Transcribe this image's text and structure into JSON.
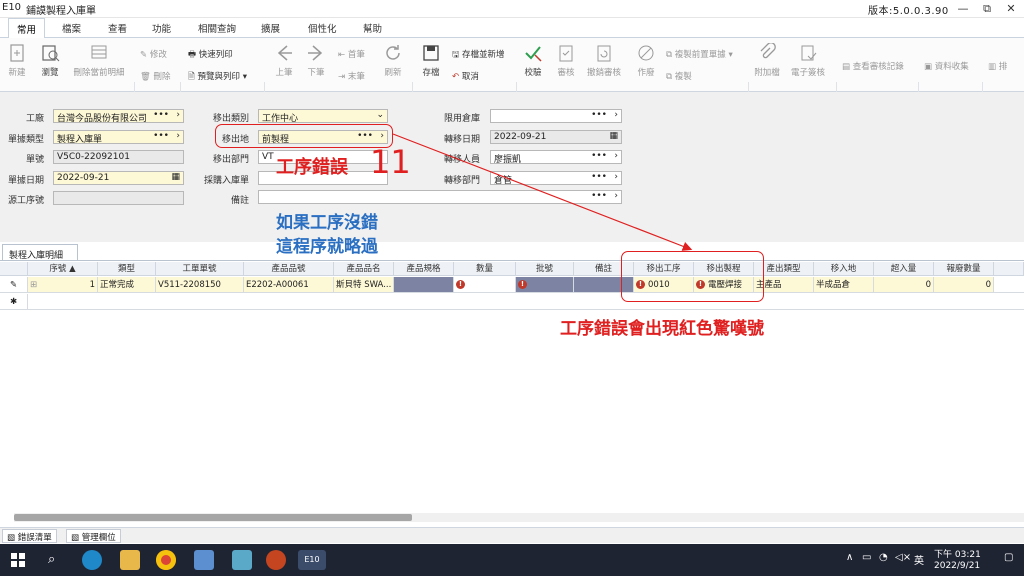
{
  "titlebar": {
    "app": "E10",
    "title": "鋪謨製程入庫單",
    "version": "版本:5.0.0.3.90",
    "minimize": "—",
    "restore": "⧉",
    "close": "✕"
  },
  "menu": [
    "常用",
    "檔案",
    "查看",
    "功能",
    "相關查詢",
    "擴展",
    "個性化",
    "幫助"
  ],
  "ribbon": {
    "new": "新建",
    "browse": "瀏覽",
    "delete_current": "刪除當前明細",
    "modify": "修改",
    "delete": "刪除",
    "quick_print": "快速列印",
    "preview_print": "預覽與列印",
    "prev": "上筆",
    "next": "下筆",
    "first": "首筆",
    "last": "末筆",
    "refresh": "刷新",
    "save": "存檔",
    "save_new": "存檔並新增",
    "cancel": "取消",
    "verify": "校驗",
    "approve": "審核",
    "unapprove": "撤銷審核",
    "void": "作廢",
    "copy_prev": "複製前置單據",
    "copy": "複製",
    "attach": "附加檔",
    "esign": "電子簽核",
    "view_audit": "查看審核記錄",
    "collect": "資料收集",
    "ext": "排"
  },
  "form": {
    "factory_label": "工廠",
    "factory_value": "台灣今品股份有限公司",
    "doctype_label": "單據類型",
    "doctype_value": "製程入庫單",
    "docno_label": "單號",
    "docno_value": "V5C0-22092101",
    "docdate_label": "單據日期",
    "docdate_value": "2022-09-21",
    "source_label": "源工序號",
    "source_value": "",
    "outtype_label": "移出類別",
    "outtype_value": "工作中心",
    "outplace_label": "移出地",
    "outplace_value": "前製程",
    "outdept_label": "移出部門",
    "outdept_value": "VT",
    "purchase_label": "採購入庫單",
    "purchase_value": "",
    "remark_label": "備註",
    "remark_value": "",
    "limitwh_label": "限用倉庫",
    "limitwh_value": "",
    "transdate_label": "轉移日期",
    "transdate_value": "2022-09-21",
    "transperson_label": "轉移人員",
    "transperson_value": "廖振凱",
    "transdept_label": "轉移部門",
    "transdept_value": "倉管"
  },
  "detail_tab": "製程入庫明細",
  "grid": {
    "headers": [
      "序號",
      "類型",
      "工單單號",
      "產品品號",
      "產品品名",
      "產品規格",
      "數量",
      "批號",
      "備註",
      "移出工序",
      "移出製程",
      "產出類型",
      "移入地",
      "超入量",
      "報廢數量"
    ],
    "row": {
      "seq": "1",
      "type": "正常完成",
      "wo": "V511-2208150",
      "item": "E2202-A00061",
      "name": "斯貝特 SWA...",
      "spec": "",
      "qty": "",
      "lot": "",
      "remark": "",
      "op": "0010",
      "proc": "電壓焊接",
      "outtype": "主產品",
      "inplace": "半成品倉",
      "over": "0",
      "scrap": "0"
    }
  },
  "bottom_tabs": [
    "錯誤清單",
    "管理欄位"
  ],
  "annotations": {
    "process_error": "工序錯誤",
    "number": "11",
    "skip_line1": "如果工序沒錯",
    "skip_line2": "這程序就略過",
    "red_exclaim": "工序錯誤會出現紅色驚嘆號"
  },
  "tray": {
    "lang": "英",
    "time": "下午 03:21",
    "date": "2022/9/21"
  }
}
